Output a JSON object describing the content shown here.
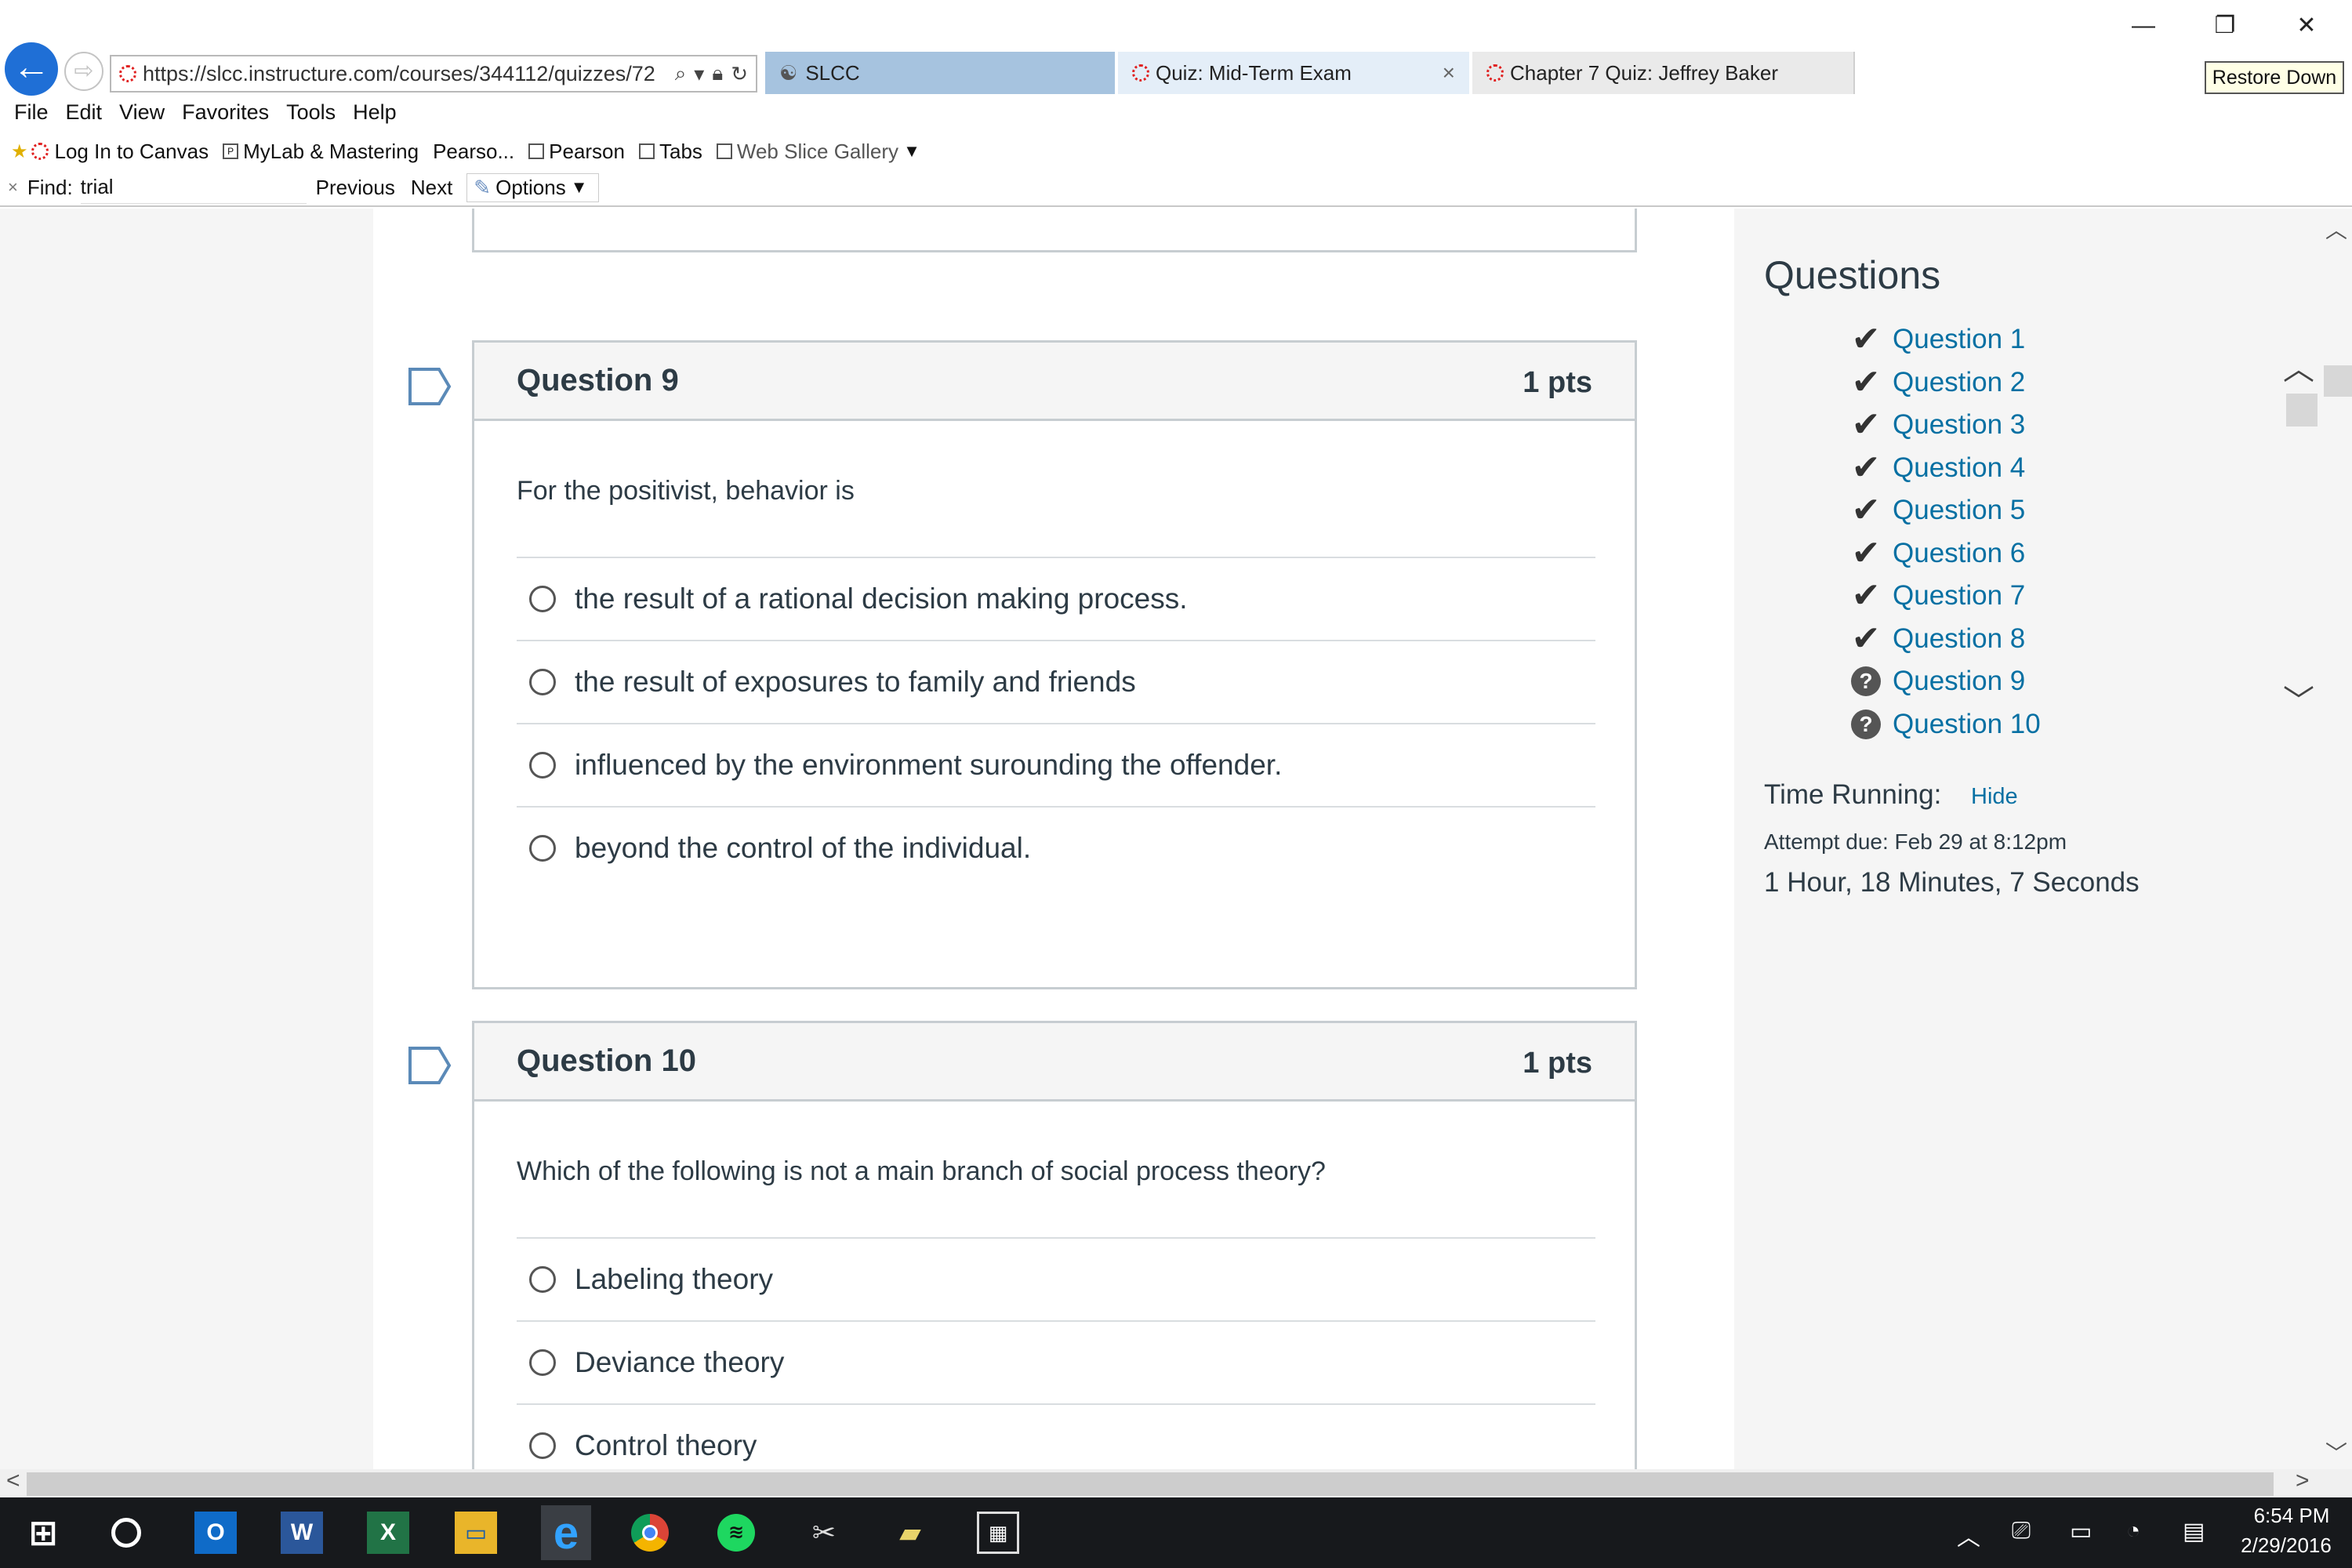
{
  "browser": {
    "url": "https://slcc.instructure.com/courses/344112/quizzes/72",
    "tabs": [
      {
        "label": "SLCC"
      },
      {
        "label": "Quiz: Mid-Term Exam",
        "close": "×"
      },
      {
        "label": "Chapter 7 Quiz: Jeffrey Baker"
      }
    ],
    "window_buttons": {
      "minimize": "—",
      "restore": "❐",
      "close": "✕"
    },
    "tooltip": "Restore Down",
    "menu": [
      "File",
      "Edit",
      "View",
      "Favorites",
      "Tools",
      "Help"
    ],
    "favorites": [
      {
        "label": "Log In to Canvas"
      },
      {
        "label": "MyLab & Mastering"
      },
      {
        "label": "Pearso..."
      },
      {
        "label": "Pearson"
      },
      {
        "label": "Tabs"
      },
      {
        "label": "Web Slice Gallery"
      }
    ],
    "find": {
      "close": "×",
      "label": "Find:",
      "value": "trial",
      "previous": "Previous",
      "next": "Next",
      "options": "Options"
    }
  },
  "questions": [
    {
      "title": "Question 9",
      "points": "1 pts",
      "text": "For the positivist, behavior is",
      "answers": [
        "the result of a rational decision making process.",
        "the result of exposures to family and friends",
        "influenced by the environment surounding the offender.",
        "beyond the control of the individual."
      ]
    },
    {
      "title": "Question 10",
      "points": "1 pts",
      "text": "Which of the following is not a main branch of social process theory?",
      "answers": [
        "Labeling theory",
        "Deviance theory",
        "Control theory"
      ]
    }
  ],
  "sidebar": {
    "title": "Questions",
    "items": [
      {
        "label": "Question 1",
        "status": "answered"
      },
      {
        "label": "Question 2",
        "status": "answered"
      },
      {
        "label": "Question 3",
        "status": "answered"
      },
      {
        "label": "Question 4",
        "status": "answered"
      },
      {
        "label": "Question 5",
        "status": "answered"
      },
      {
        "label": "Question 6",
        "status": "answered"
      },
      {
        "label": "Question 7",
        "status": "answered"
      },
      {
        "label": "Question 8",
        "status": "answered"
      },
      {
        "label": "Question 9",
        "status": "unanswered"
      },
      {
        "label": "Question 10",
        "status": "unanswered"
      }
    ],
    "time_label": "Time Running:",
    "hide_label": "Hide",
    "attempt_due": "Attempt due: Feb 29 at 8:12pm",
    "time_value": "1 Hour, 18 Minutes, 7 Seconds"
  },
  "taskbar": {
    "apps": [
      "start-icon",
      "cortana-icon",
      "outlook-icon",
      "word-icon",
      "excel-icon",
      "file-explorer-icon",
      "internet-explorer-icon",
      "chrome-icon",
      "spotify-icon",
      "snipping-tool-icon",
      "eraser-app-icon",
      "calculator-icon"
    ],
    "time": "6:54 PM",
    "date": "2/29/2016"
  },
  "colors": {
    "link": "#0770a3",
    "text": "#2d3b45",
    "active_tab": "#a6c3df",
    "border": "#c7cdd1"
  }
}
